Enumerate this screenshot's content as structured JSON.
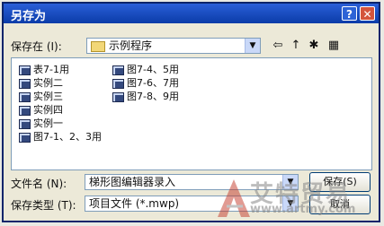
{
  "title": "另存为",
  "title_buttons": {
    "help": "?",
    "close": "✕"
  },
  "save_in": {
    "label": "保存在 (I):",
    "value": "示例程序"
  },
  "toolbar": {
    "back_icon": "back-icon",
    "up_icon": "up-folder-icon",
    "new_folder_icon": "new-folder-icon",
    "view_icon": "view-menu-icon"
  },
  "files_col1": [
    "表7-1用",
    "实例二",
    "实例三",
    "实例四",
    "实例一",
    "图7-1、2、3用"
  ],
  "files_col2": [
    "图7-4、5用",
    "图7-6、7用",
    "图7-8、9用"
  ],
  "filename": {
    "label": "文件名 (N):",
    "value": "梯形图编辑器录入"
  },
  "filetype": {
    "label": "保存类型 (T):",
    "value": "项目文件 (*.mwp)"
  },
  "buttons": {
    "save": "保存(S)",
    "cancel": "取消"
  },
  "watermark": {
    "brand": "艾特贸易",
    "url": "www.artmy.com"
  }
}
